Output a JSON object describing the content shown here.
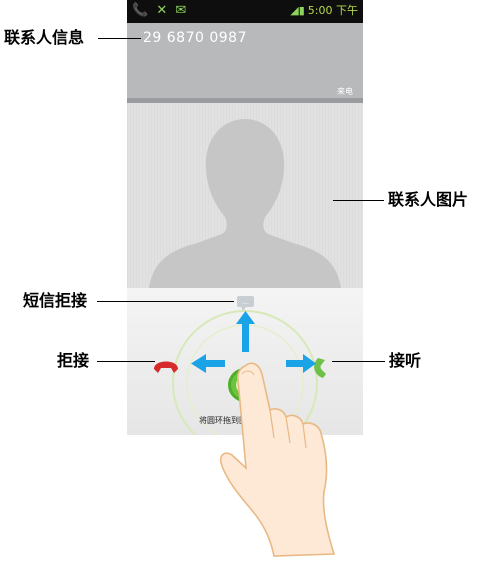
{
  "status_bar": {
    "left_icons": "📞 ✕ ✉",
    "signal_icon": "signal-icon",
    "time": "5:00 下午"
  },
  "caller": {
    "number": "29 6870 0987",
    "state": "来电"
  },
  "lock_screen": {
    "instruction": "将圆环拖到图... 撤"
  },
  "annotations": {
    "contact_info": "联系人信息",
    "contact_photo": "联系人图片",
    "reject_with_sms": "短信拒接",
    "reject": "拒接",
    "answer": "接听"
  },
  "colors": {
    "header_bg": "#b7b9bb",
    "status_bg": "#0e0e0e",
    "answer_green": "#4fae2a",
    "reject_red": "#d72b2b",
    "arrow_blue": "#1aa3e6"
  }
}
